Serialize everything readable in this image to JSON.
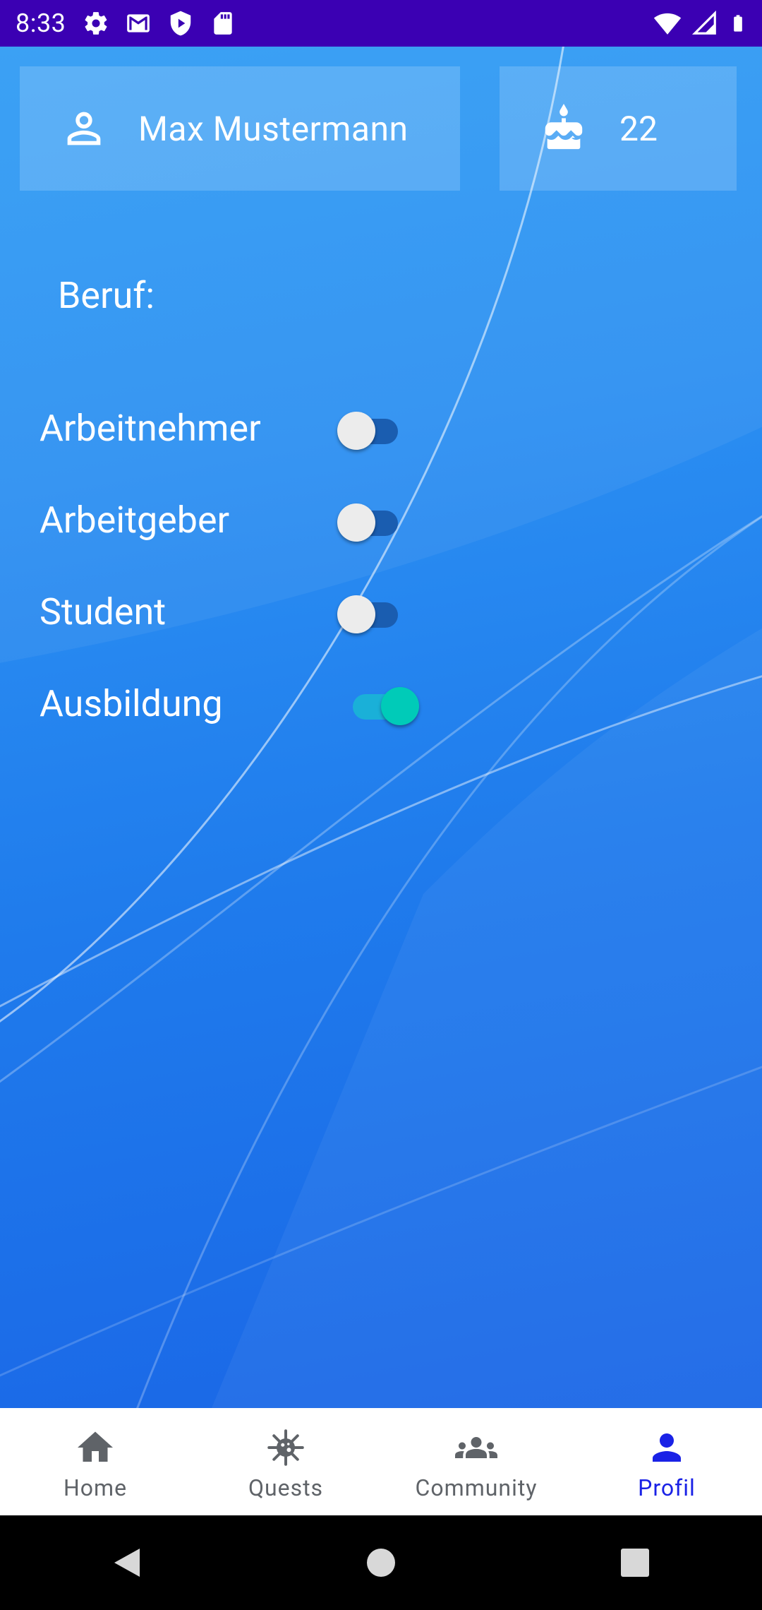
{
  "status_bar": {
    "time": "8:33",
    "icons_left": [
      "settings-icon",
      "gmail-icon",
      "shield-play-icon",
      "sd-card-icon"
    ],
    "icons_right": [
      "wifi-icon",
      "cellular-signal-icon",
      "battery-icon"
    ]
  },
  "profile": {
    "name": "Max Mustermann",
    "age": "22",
    "name_icon": "person-outline-icon",
    "age_icon": "cake-icon"
  },
  "beruf": {
    "label": "Beruf:",
    "options": [
      {
        "label": "Arbeitnehmer",
        "enabled": false
      },
      {
        "label": "Arbeitgeber",
        "enabled": false
      },
      {
        "label": "Student",
        "enabled": false
      },
      {
        "label": "Ausbildung",
        "enabled": true
      }
    ]
  },
  "bottom_nav": {
    "items": [
      {
        "label": "Home",
        "icon": "home-icon",
        "active": false
      },
      {
        "label": "Quests",
        "icon": "virus-icon",
        "active": false
      },
      {
        "label": "Community",
        "icon": "group-icon",
        "active": false
      },
      {
        "label": "Profil",
        "icon": "person-icon",
        "active": true
      }
    ]
  },
  "system_nav": [
    "back-button",
    "home-button",
    "recents-button"
  ],
  "colors": {
    "status_bar": "#3b00b3",
    "background": "#2b8ff2",
    "active_nav": "#1a22e6",
    "switch_on": "#00cbb8"
  }
}
